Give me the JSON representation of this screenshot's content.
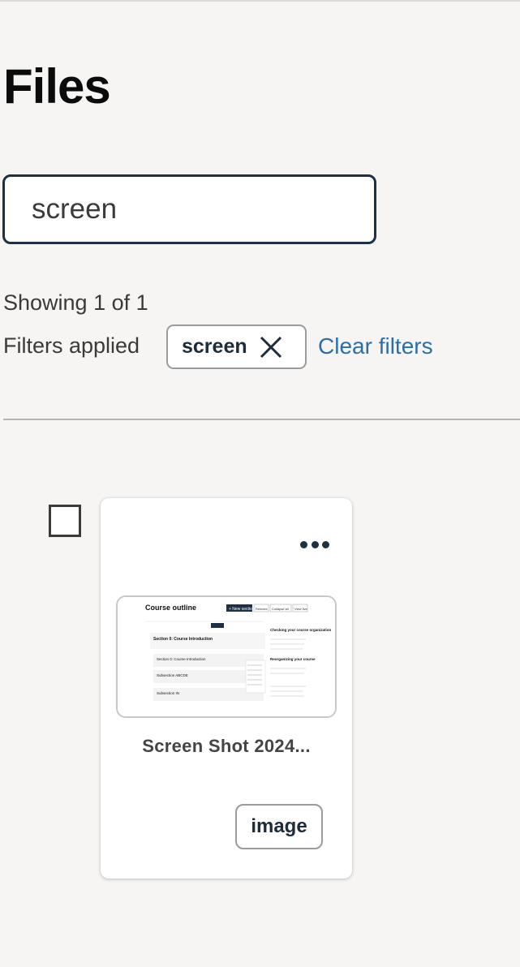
{
  "page": {
    "title": "Files"
  },
  "search": {
    "value": "screen"
  },
  "results": {
    "showing_text": "Showing 1 of 1",
    "filters_label": "Filters applied",
    "active_filter": "screen",
    "clear_filters_label": "Clear filters"
  },
  "files": [
    {
      "name": "Screen Shot 2024...",
      "type": "image",
      "selected": false
    }
  ],
  "thumbnail": {
    "title": "Course outline",
    "section": "Section 0: Course Introduction",
    "sub1": "Section 0: Course Introduction",
    "sub2": "Subsection ABCDE",
    "sub3": "Subsection IN",
    "btn_new": "+ New section",
    "btn_reindex": "Reindex",
    "btn_collapse": "Collapse all",
    "btn_view": "View live",
    "side_title": "Checking your course organization",
    "side_reorg": "Reorganizing your course"
  },
  "icons": {
    "more": "more-horizontal-icon",
    "close": "close-icon"
  },
  "colors": {
    "accent": "#1d3044",
    "link": "#2c6ea5",
    "background": "#f6f5f3"
  }
}
